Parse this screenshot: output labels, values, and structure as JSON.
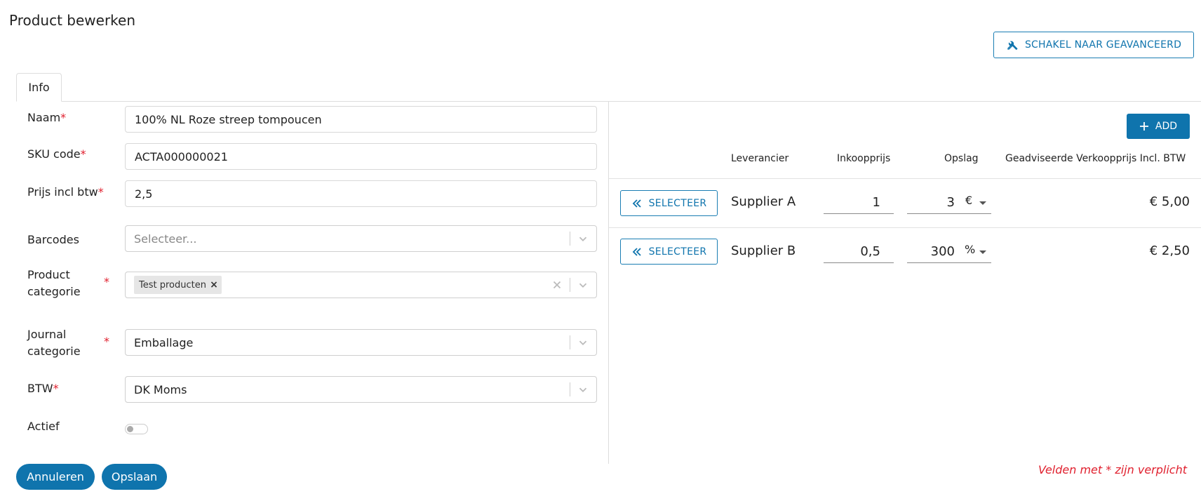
{
  "page": {
    "title": "Product bewerken"
  },
  "header": {
    "advanced_label": "SCHAKEL NAAR GEAVANCEERD"
  },
  "tabs": [
    {
      "label": "Info"
    }
  ],
  "form": {
    "name": {
      "label": "Naam",
      "required_mark": "*",
      "value": "100% NL Roze streep tompoucen"
    },
    "sku": {
      "label": "SKU code",
      "required_mark": "*",
      "value": "ACTA000000021"
    },
    "price": {
      "label": "Prijs incl btw",
      "required_mark": "*",
      "value": "2,5"
    },
    "barcodes": {
      "label": "Barcodes",
      "placeholder": "Selecteer..."
    },
    "product_category": {
      "label_line1": "Product",
      "label_line2": "categorie",
      "required_mark": "*",
      "chip": "Test producten",
      "chip_remove": "×"
    },
    "journal_category": {
      "label_line1": "Journal",
      "label_line2": "categorie",
      "required_mark": "*",
      "value": "Emballage"
    },
    "vat": {
      "label": "BTW",
      "required_mark": "*",
      "value": "DK Moms"
    },
    "active": {
      "label": "Actief",
      "on": false
    }
  },
  "actions": {
    "cancel_label": "Annuleren",
    "save_label": "Opslaan"
  },
  "suppliers": {
    "add_label": "ADD",
    "columns": {
      "supplier": "Leverancier",
      "purchase_price": "Inkoopprijs",
      "markup": "Opslag",
      "advised_price": "Geadviseerde Verkoopprijs Incl. BTW"
    },
    "rows": [
      {
        "select_label": "SELECTEER",
        "supplier": "Supplier A",
        "purchase_price": "1",
        "markup": "3",
        "markup_unit": "€",
        "advised_price": "€ 5,00"
      },
      {
        "select_label": "SELECTEER",
        "supplier": "Supplier B",
        "purchase_price": "0,5",
        "markup": "300",
        "markup_unit": "%",
        "advised_price": "€ 2,50"
      }
    ]
  },
  "footer": {
    "required_note": "Velden met * zijn verplicht"
  },
  "colors": {
    "primary": "#0f74ad",
    "required": "#e0202e",
    "border": "#d8d8d8"
  }
}
